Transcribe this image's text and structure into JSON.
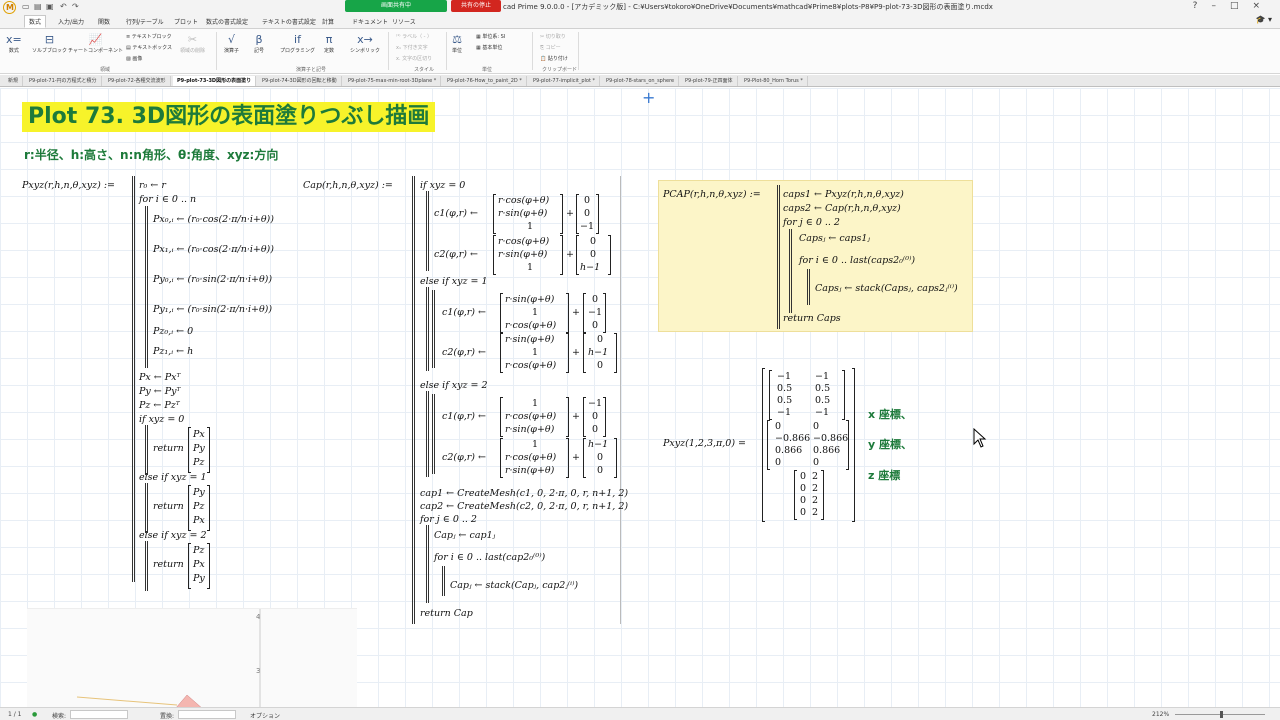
{
  "titlebar": {
    "logo": "M",
    "share_status": "画面共有中",
    "share_stop": "共有の停止",
    "window_title": "cad Prime 9.0.0.0 - [アカデミック版] - C:¥Users¥tokoro¥OneDrive¥Documents¥mathcad¥Prime8¥plots-P8¥P9-plot-73-3D図形の表面塗り.mcdx"
  },
  "ribbon_tabs": [
    "数式",
    "入力/出力",
    "関数",
    "行列/テーブル",
    "プロット",
    "数式の書式設定",
    "テキストの書式設定",
    "計算",
    "ドキュメント",
    "リソース"
  ],
  "ribbon": {
    "math_button": "数式",
    "solve_block": "ソルブブロック",
    "chart_component": "チャートコンポーネント",
    "text_block": "テキストブロック",
    "text_box": "テキストボックス",
    "image": "画像",
    "delete_region": "領域の削除",
    "operators": "演算子",
    "symbols": "記号",
    "programming": "プログラミング",
    "constants": "定数",
    "symbolic": "シンボリック",
    "label_dropdown": "ラベル（ - ）",
    "subscript": "下付き文字",
    "literal": "文字の区切り",
    "units_button": "単位",
    "unit_system": "単位系: SI",
    "base_units": "基本単位",
    "cut": "切り取り",
    "copy": "コピー",
    "paste": "貼り付け",
    "group_regions": "領域",
    "group_operators": "演算子と記号",
    "group_style": "スタイル",
    "group_units": "単位",
    "group_clipboard": "クリップボード"
  },
  "doc_tabs": [
    {
      "label": "新規",
      "active": false
    },
    {
      "label": "P9-plot-71-円の方程式と積分",
      "active": false
    },
    {
      "label": "P9-plot-72-各種交流波形",
      "active": false
    },
    {
      "label": "P9-plot-73-3D図形の表面塗り",
      "active": true
    },
    {
      "label": "P9-plot-74-3D図形の回転と移動",
      "active": false
    },
    {
      "label": "P9-plot-75-max-min-root-3Dplane *",
      "active": false
    },
    {
      "label": "P9-plot-76-How_to_paint_2D *",
      "active": false
    },
    {
      "label": "P9-plot-77-implicit_plot *",
      "active": false
    },
    {
      "label": "P9-plot-78-stars_on_sphere",
      "active": false
    },
    {
      "label": "P9-plot-79-正四面体",
      "active": false
    },
    {
      "label": "P9-Plot-80_Horn Torus *",
      "active": false
    }
  ],
  "worksheet": {
    "title": "Plot 73. 3D図形の表面塗りつぶし描画",
    "subtitle": "r:半径、h:高さ、n:n角形、θ:角度、xyz:方向"
  },
  "pxyz": {
    "def": "Pxyz(r,h,n,θ,xyz) :=",
    "l1": "r₀ ← r",
    "l2": "for i ∈ 0 .. n",
    "l3": "Px₀,ᵢ ← (r₀·cos(2·π/n·i+θ))",
    "l4": "Px₁,ᵢ ← (r₀·cos(2·π/n·i+θ))",
    "l5": "Py₀,ᵢ ← (r₀·sin(2·π/n·i+θ))",
    "l6": "Py₁,ᵢ ← (r₀·sin(2·π/n·i+θ))",
    "l7": "Pz₀,ᵢ ← 0",
    "l8": "Pz₁,ᵢ ← h",
    "l9": "Px ← Pxᵀ",
    "l10": "Py ← Pyᵀ",
    "l11": "Pz ← Pzᵀ",
    "l12": "if xyz = 0",
    "l13": "return",
    "v1": [
      "Px",
      "Py",
      "Pz"
    ],
    "l14": "else if xyz = 1",
    "v2": [
      "Py",
      "Pz",
      "Px"
    ],
    "l15": "else if xyz = 2",
    "v3": [
      "Pz",
      "Px",
      "Py"
    ]
  },
  "cap": {
    "def": "Cap(r,h,n,θ,xyz) :=",
    "if0": "if xyz = 0",
    "c1": "c1(φ,r) ←",
    "c2": "c2(φ,r) ←",
    "m_rcos": "r·cos(φ+θ)",
    "m_rsin": "r·sin(φ+θ)",
    "one": "1",
    "plus": "+",
    "v_c1_0": [
      "0",
      "0",
      "−1"
    ],
    "v_c2_0": [
      "0",
      "0",
      "h−1"
    ],
    "if1": "else if xyz = 1",
    "v_c1_1": [
      "0",
      "−1",
      "0"
    ],
    "v_c2_1": [
      "0",
      "h−1",
      "0"
    ],
    "if2": "else if xyz = 2",
    "v_c1_2": [
      "−1",
      "0",
      "0"
    ],
    "v_c2_2": [
      "h−1",
      "0",
      "0"
    ],
    "mesh1": "cap1 ← CreateMesh(c1, 0, 2·π, 0, r, n+1, 2)",
    "mesh2": "cap2 ← CreateMesh(c2, 0, 2·π, 0, r, n+1, 2)",
    "forj": "for j ∈ 0 .. 2",
    "capj": "Capⱼ ← cap1ⱼ",
    "fori": "for i ∈ 0 .. last(cap2₀⁽⁰⁾)",
    "stack": "Capⱼ ← stack(Capⱼ, cap2ⱼ⁽ⁱ⁾)",
    "ret": "return Cap"
  },
  "pcap": {
    "def": "PCAP(r,h,n,θ,xyz) :=",
    "l1": "caps1 ← Pxyz(r,h,n,θ,xyz)",
    "l2": "caps2 ← Cap(r,h,n,θ,xyz)",
    "l3": "for j ∈ 0 .. 2",
    "l4": "Capsⱼ ← caps1ⱼ",
    "l5": "for i ∈ 0 .. last(caps2₀⁽⁰⁾)",
    "l6": "Capsⱼ ← stack(Capsⱼ, caps2ⱼ⁽ⁱ⁾)",
    "l7": "return Caps"
  },
  "result": {
    "expr": "Pxyz(1,2,3,π,0) =",
    "mx": [
      [
        "−1",
        "−1"
      ],
      [
        "0.5",
        "0.5"
      ],
      [
        "0.5",
        "0.5"
      ],
      [
        "−1",
        "−1"
      ]
    ],
    "my": [
      [
        "0",
        "0"
      ],
      [
        "−0.866",
        "−0.866"
      ],
      [
        "0.866",
        "0.866"
      ],
      [
        "0",
        "0"
      ]
    ],
    "mz": [
      [
        "0",
        "2"
      ],
      [
        "0",
        "2"
      ],
      [
        "0",
        "2"
      ],
      [
        "0",
        "2"
      ]
    ],
    "label_x": "x 座標、",
    "label_y": "y 座標、",
    "label_z": "z 座標"
  },
  "plot_ticks": [
    "4",
    "3"
  ],
  "status": {
    "page": "1 / 1",
    "find_label": "検索:",
    "replace_label": "置換:",
    "options": "オプション",
    "zoom": "212%",
    "zoom_fraction": 0.52
  }
}
